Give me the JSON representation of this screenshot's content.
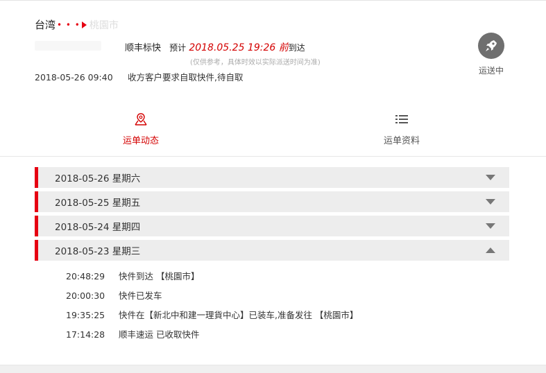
{
  "shipment": {
    "origin": "台湾",
    "route_dots": "• • •",
    "destination_partial": "桃園市",
    "service": "顺丰标快",
    "eta_label": "预计",
    "eta": "2018.05.25 19:26 前",
    "eta_suffix": "到达",
    "note": "(仅供参考，具体时效以实际派送时间为准)",
    "latest_time": "2018-05-26 09:40",
    "latest_text": "收方客户要求自取快件,待自取",
    "status": "运送中",
    "status_icon": "rocket-icon"
  },
  "tabs": [
    {
      "label": "运单动态",
      "icon": "map-pin-icon",
      "active": true
    },
    {
      "label": "运单资料",
      "icon": "list-icon",
      "active": false
    }
  ],
  "days": [
    {
      "label": "2018-05-26 星期六",
      "expanded": false
    },
    {
      "label": "2018-05-25 星期五",
      "expanded": false
    },
    {
      "label": "2018-05-24 星期四",
      "expanded": false
    },
    {
      "label": "2018-05-23 星期三",
      "expanded": true
    }
  ],
  "events": [
    {
      "time": "20:48:29",
      "text": "快件到达 【桃園市】"
    },
    {
      "time": "20:00:30",
      "text": "快件已发车"
    },
    {
      "time": "19:35:25",
      "text": "快件在【新北中和建一理貨中心】已装车,准备发往 【桃園市】"
    },
    {
      "time": "17:14:28",
      "text": "顺丰速运 已收取快件"
    }
  ],
  "colors": {
    "accent": "#e60012",
    "eta": "#d40000",
    "status_circle": "#6f6f6f"
  }
}
